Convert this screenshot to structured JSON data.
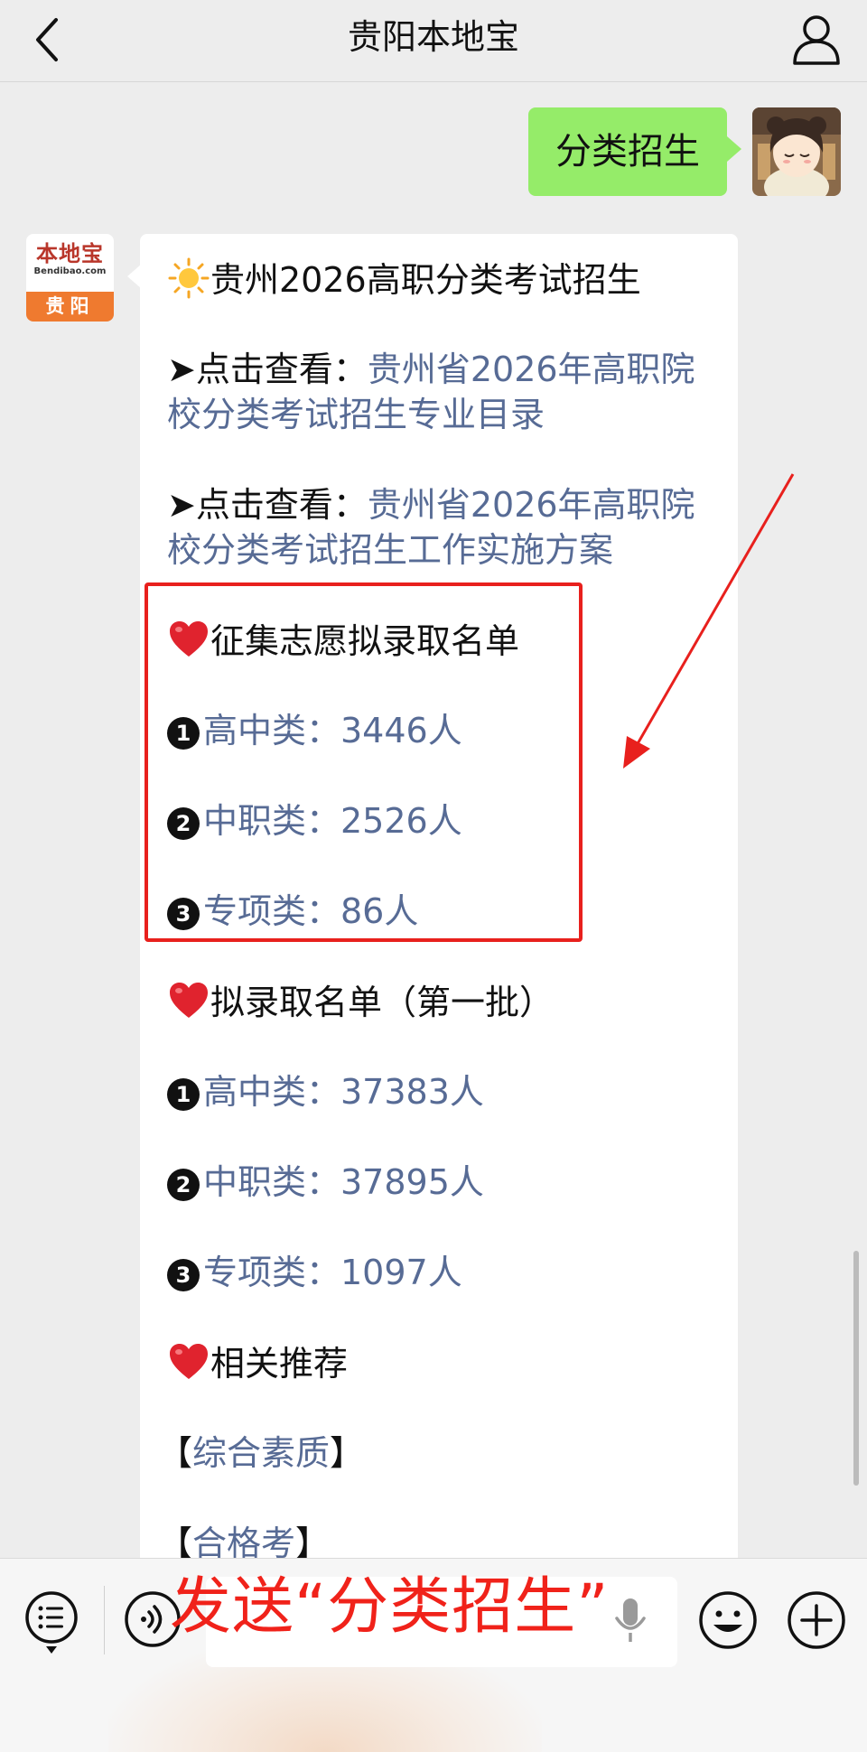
{
  "header": {
    "title": "贵阳本地宝",
    "back_icon": "chevron-left-icon",
    "profile_icon": "person-icon"
  },
  "sent_message": {
    "text": "分类招生",
    "bubble_color": "#95ec69"
  },
  "bot_avatar": {
    "logo_cn": "本地宝",
    "logo_en": "Bendibao.com",
    "city": "贵阳",
    "brand_color": "#ef7a2f"
  },
  "received_message": {
    "headline": "贵州2026高职分类考试招生",
    "links": [
      {
        "prefix": "➤点击查看：",
        "line1": "贵州省2026年高职院",
        "line2": "校分类考试招生专业目录"
      },
      {
        "prefix": "➤点击查看：",
        "line1": "贵州省2026年高职院",
        "line2": "校分类考试招生工作实施方案"
      }
    ],
    "section1": {
      "title": "征集志愿拟录取名单",
      "items": [
        {
          "num": "1",
          "text": "高中类：3446人"
        },
        {
          "num": "2",
          "text": "中职类：2526人"
        },
        {
          "num": "3",
          "text": "专项类：86人"
        }
      ]
    },
    "section2": {
      "title": "拟录取名单（第一批）",
      "items": [
        {
          "num": "1",
          "text": "高中类：37383人"
        },
        {
          "num": "2",
          "text": "中职类：37895人"
        },
        {
          "num": "3",
          "text": "专项类：1097人"
        }
      ]
    },
    "section3": {
      "title": "相关推荐",
      "links": [
        {
          "open": "【",
          "label": "综合素质",
          "close": "】"
        },
        {
          "open": "【",
          "label": "合格考",
          "close": "】"
        }
      ]
    },
    "link_color": "#576b95"
  },
  "annotation": {
    "overlay_text": "发送“分类招生”",
    "highlight_color": "#e8201d"
  },
  "input_bar": {
    "menu_icon": "list-menu-icon",
    "voice_icon": "voice-icon",
    "mic_icon": "microphone-icon",
    "emoji_icon": "smiley-icon",
    "plus_icon": "plus-icon"
  }
}
